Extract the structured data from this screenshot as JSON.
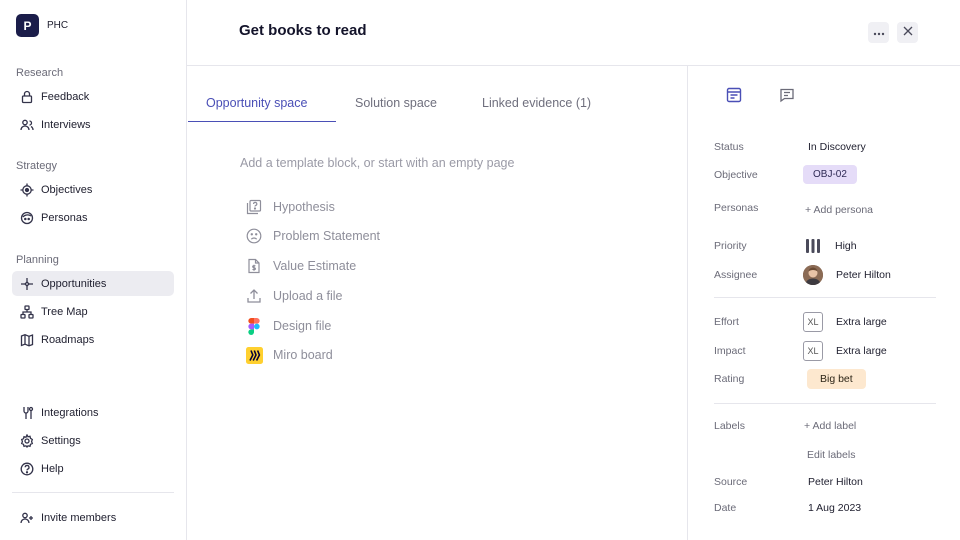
{
  "workspace": {
    "initial": "P",
    "name": "PHC"
  },
  "sidebar": {
    "sections": [
      {
        "title": "Research",
        "items": [
          {
            "label": "Feedback",
            "icon": "lock-icon"
          },
          {
            "label": "Interviews",
            "icon": "users-icon"
          }
        ]
      },
      {
        "title": "Strategy",
        "items": [
          {
            "label": "Objectives",
            "icon": "target-icon"
          },
          {
            "label": "Personas",
            "icon": "persona-face-icon"
          }
        ]
      },
      {
        "title": "Planning",
        "items": [
          {
            "label": "Opportunities",
            "icon": "sparkle-icon",
            "active": true
          },
          {
            "label": "Tree Map",
            "icon": "tree-map-icon"
          },
          {
            "label": "Roadmaps",
            "icon": "map-icon"
          }
        ]
      }
    ],
    "footer": [
      {
        "label": "Integrations",
        "icon": "integrations-icon"
      },
      {
        "label": "Settings",
        "icon": "gear-icon"
      },
      {
        "label": "Help",
        "icon": "help-icon"
      }
    ],
    "invite": {
      "label": "Invite members",
      "icon": "add-user-icon"
    }
  },
  "header": {
    "title": "Get books to read"
  },
  "main": {
    "tabs": [
      {
        "label": "Opportunity space",
        "active": true
      },
      {
        "label": "Solution space"
      },
      {
        "label": "Linked evidence (1)"
      }
    ],
    "placeholder": "Add a template block, or start with an empty page",
    "blocks": [
      {
        "label": "Hypothesis",
        "icon": "hypothesis-icon"
      },
      {
        "label": "Problem Statement",
        "icon": "frown-face-icon"
      },
      {
        "label": "Value Estimate",
        "icon": "dollar-document-icon"
      },
      {
        "label": "Upload a file",
        "icon": "upload-icon"
      },
      {
        "label": "Design file",
        "icon": "figma-icon"
      },
      {
        "label": "Miro board",
        "icon": "miro-icon"
      }
    ]
  },
  "panel": {
    "status": {
      "label": "Status",
      "value": "In Discovery"
    },
    "objective": {
      "label": "Objective",
      "value": "OBJ-02"
    },
    "personas": {
      "label": "Personas",
      "action": "+ Add persona"
    },
    "priority": {
      "label": "Priority",
      "value": "High"
    },
    "assignee": {
      "label": "Assignee",
      "value": "Peter Hilton"
    },
    "effort": {
      "label": "Effort",
      "badge": "XL",
      "value": "Extra large"
    },
    "impact": {
      "label": "Impact",
      "badge": "XL",
      "value": "Extra large"
    },
    "rating": {
      "label": "Rating",
      "value": "Big bet"
    },
    "labels": {
      "label": "Labels",
      "action": "+ Add label",
      "edit": "Edit labels"
    },
    "source": {
      "label": "Source",
      "value": "Peter Hilton"
    },
    "date": {
      "label": "Date",
      "value": "1 Aug 2023"
    }
  },
  "colors": {
    "accent": "#4a4fb6",
    "brand": "#1b1d4a",
    "objective_pill": "#e5dcf8",
    "rating_pill": "#fde8cf"
  }
}
